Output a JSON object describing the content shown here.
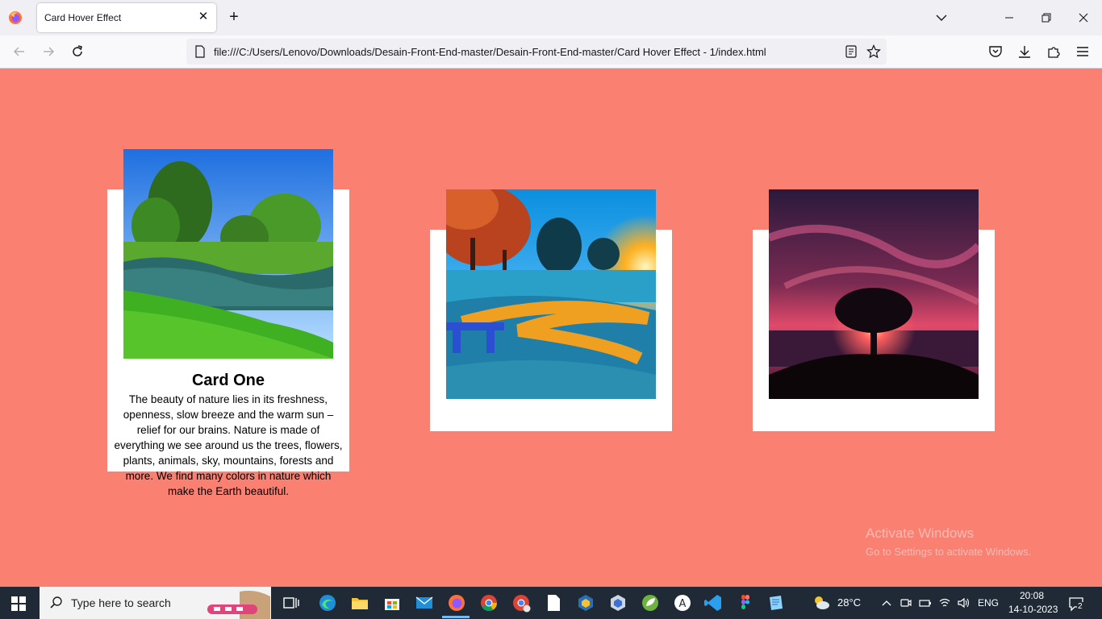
{
  "browser": {
    "tab_title": "Card Hover Effect",
    "url": "file:///C:/Users/Lenovo/Downloads/Desain-Front-End-master/Desain-Front-End-master/Card Hover Effect - 1/index.html"
  },
  "cards": [
    {
      "title": "Card One",
      "text": "The beauty of nature lies in its freshness, openness, slow breeze and the warm sun – relief for our brains. Nature is made of everything we see around us the trees, flowers, plants, animals, sky, mountains, forests and more. We find many colors in nature which make the Earth beautiful."
    },
    {
      "title": "",
      "text": ""
    },
    {
      "title": "",
      "text": ""
    }
  ],
  "watermark": {
    "line1": "Activate Windows",
    "line2": "Go to Settings to activate Windows."
  },
  "taskbar": {
    "search_placeholder": "Type here to search",
    "weather": "28°C",
    "language": "ENG",
    "time": "20:08",
    "date": "14-10-2023",
    "notification_count": "2"
  },
  "colors": {
    "page_background": "#fa8072",
    "card_background": "#ffffff",
    "taskbar": "#1f2a36"
  }
}
